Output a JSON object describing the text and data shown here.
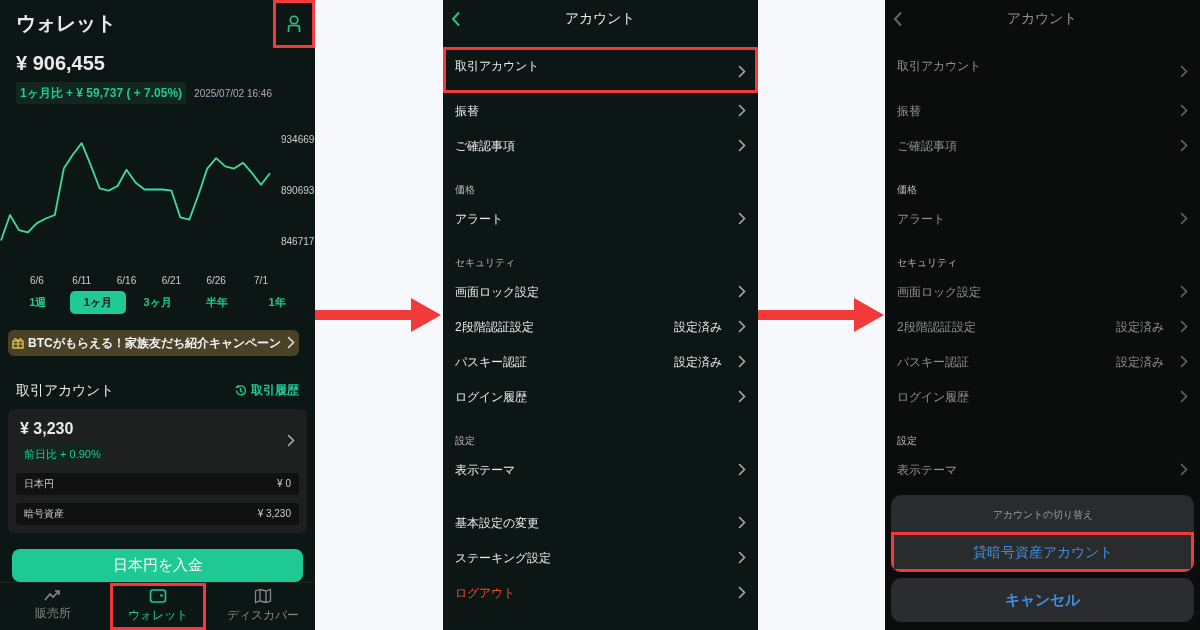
{
  "wallet": {
    "title": "ウォレット",
    "profile_button": {
      "highlighted": true
    },
    "balance": "¥ 906,455",
    "change": "1ヶ月比 + ¥ 59,737 ( + 7.05%)",
    "timestamp": "2025/07/02 16:46",
    "chart_data": {
      "type": "line",
      "categories": [
        null,
        null,
        null,
        null,
        "6/6",
        null,
        null,
        null,
        null,
        "6/11",
        null,
        null,
        null,
        null,
        "6/16",
        null,
        null,
        null,
        null,
        "6/21",
        null,
        null,
        null,
        null,
        "6/26",
        null,
        null,
        null,
        null,
        "7/1",
        null
      ],
      "values": [
        848000,
        870000,
        857000,
        855000,
        863000,
        867000,
        870000,
        910000,
        922000,
        932000,
        913000,
        893000,
        891000,
        895000,
        909000,
        898000,
        892000,
        892000,
        892000,
        891000,
        868000,
        866000,
        887000,
        910000,
        919000,
        912000,
        910000,
        915000,
        906000,
        896000,
        906000
      ],
      "ylim": [
        846717,
        934669
      ],
      "yticks": [
        846717,
        890693,
        934669
      ]
    },
    "periods": [
      {
        "label": "1週",
        "selected": false
      },
      {
        "label": "1ヶ月",
        "selected": true
      },
      {
        "label": "3ヶ月",
        "selected": false
      },
      {
        "label": "半年",
        "selected": false
      },
      {
        "label": "1年",
        "selected": false
      }
    ],
    "banner": {
      "text": "BTCがもらえる！家族友だち紹介キャンペーン"
    },
    "account": {
      "title": "取引アカウント",
      "history_link": "取引履歴",
      "total": "¥ 3,230",
      "daily_change": "前日比 + 0.90%",
      "rows": [
        {
          "label": "日本円",
          "value": "¥ 0"
        },
        {
          "label": "暗号資産",
          "value": "¥ 3,230"
        }
      ]
    },
    "deposit_button": "日本円を入金",
    "nav": [
      {
        "label": "販売所",
        "selected": false,
        "highlighted": false
      },
      {
        "label": "ウォレット",
        "selected": true,
        "highlighted": true
      },
      {
        "label": "ディスカバー",
        "selected": false,
        "highlighted": false
      }
    ]
  },
  "account_menu": {
    "title": "アカウント",
    "sections": [
      {
        "items": [
          {
            "label": "取引アカウント",
            "highlighted": true,
            "danger": false
          },
          {
            "label": "振替",
            "highlighted": false,
            "danger": false
          },
          {
            "label": "ご確認事項",
            "highlighted": false,
            "danger": false
          }
        ]
      },
      {
        "title": "価格",
        "items": [
          {
            "label": "アラート",
            "highlighted": false,
            "danger": false
          }
        ]
      },
      {
        "title": "セキュリティ",
        "items": [
          {
            "label": "画面ロック設定",
            "highlighted": false,
            "danger": false
          },
          {
            "label": "2段階認証設定",
            "value": "設定済み",
            "highlighted": false,
            "danger": false
          },
          {
            "label": "パスキー認証",
            "value": "設定済み",
            "highlighted": false,
            "danger": false
          },
          {
            "label": "ログイン履歴",
            "highlighted": false,
            "danger": false
          }
        ]
      },
      {
        "title": "設定",
        "items": [
          {
            "label": "表示テーマ",
            "highlighted": false,
            "danger": false
          }
        ]
      },
      {
        "items": [
          {
            "label": "基本設定の変更",
            "highlighted": false,
            "danger": false
          },
          {
            "label": "ステーキング設定",
            "highlighted": false,
            "danger": false
          },
          {
            "label": "ログアウト",
            "highlighted": false,
            "danger": true
          }
        ]
      }
    ]
  },
  "account_menu_with_sheet": {
    "title": "アカウント",
    "sections": [
      {
        "items": [
          {
            "label": "取引アカウント",
            "highlighted": false,
            "danger": false
          },
          {
            "label": "振替",
            "highlighted": false,
            "danger": false
          },
          {
            "label": "ご確認事項",
            "highlighted": false,
            "danger": false
          }
        ]
      },
      {
        "title": "価格",
        "items": [
          {
            "label": "アラート",
            "highlighted": false,
            "danger": false
          }
        ]
      },
      {
        "title": "セキュリティ",
        "items": [
          {
            "label": "画面ロック設定",
            "highlighted": false,
            "danger": false
          },
          {
            "label": "2段階認証設定",
            "value": "設定済み",
            "highlighted": false,
            "danger": false
          },
          {
            "label": "パスキー認証",
            "value": "設定済み",
            "highlighted": false,
            "danger": false
          },
          {
            "label": "ログイン履歴",
            "highlighted": false,
            "danger": false
          }
        ]
      },
      {
        "title": "設定",
        "items": [
          {
            "label": "表示テーマ",
            "highlighted": false,
            "danger": false
          }
        ]
      }
    ],
    "sheet": {
      "title": "アカウントの切り替え",
      "options": [
        {
          "label": "貸暗号資産アカウント",
          "highlighted": true
        }
      ],
      "cancel": "キャンセル"
    }
  }
}
